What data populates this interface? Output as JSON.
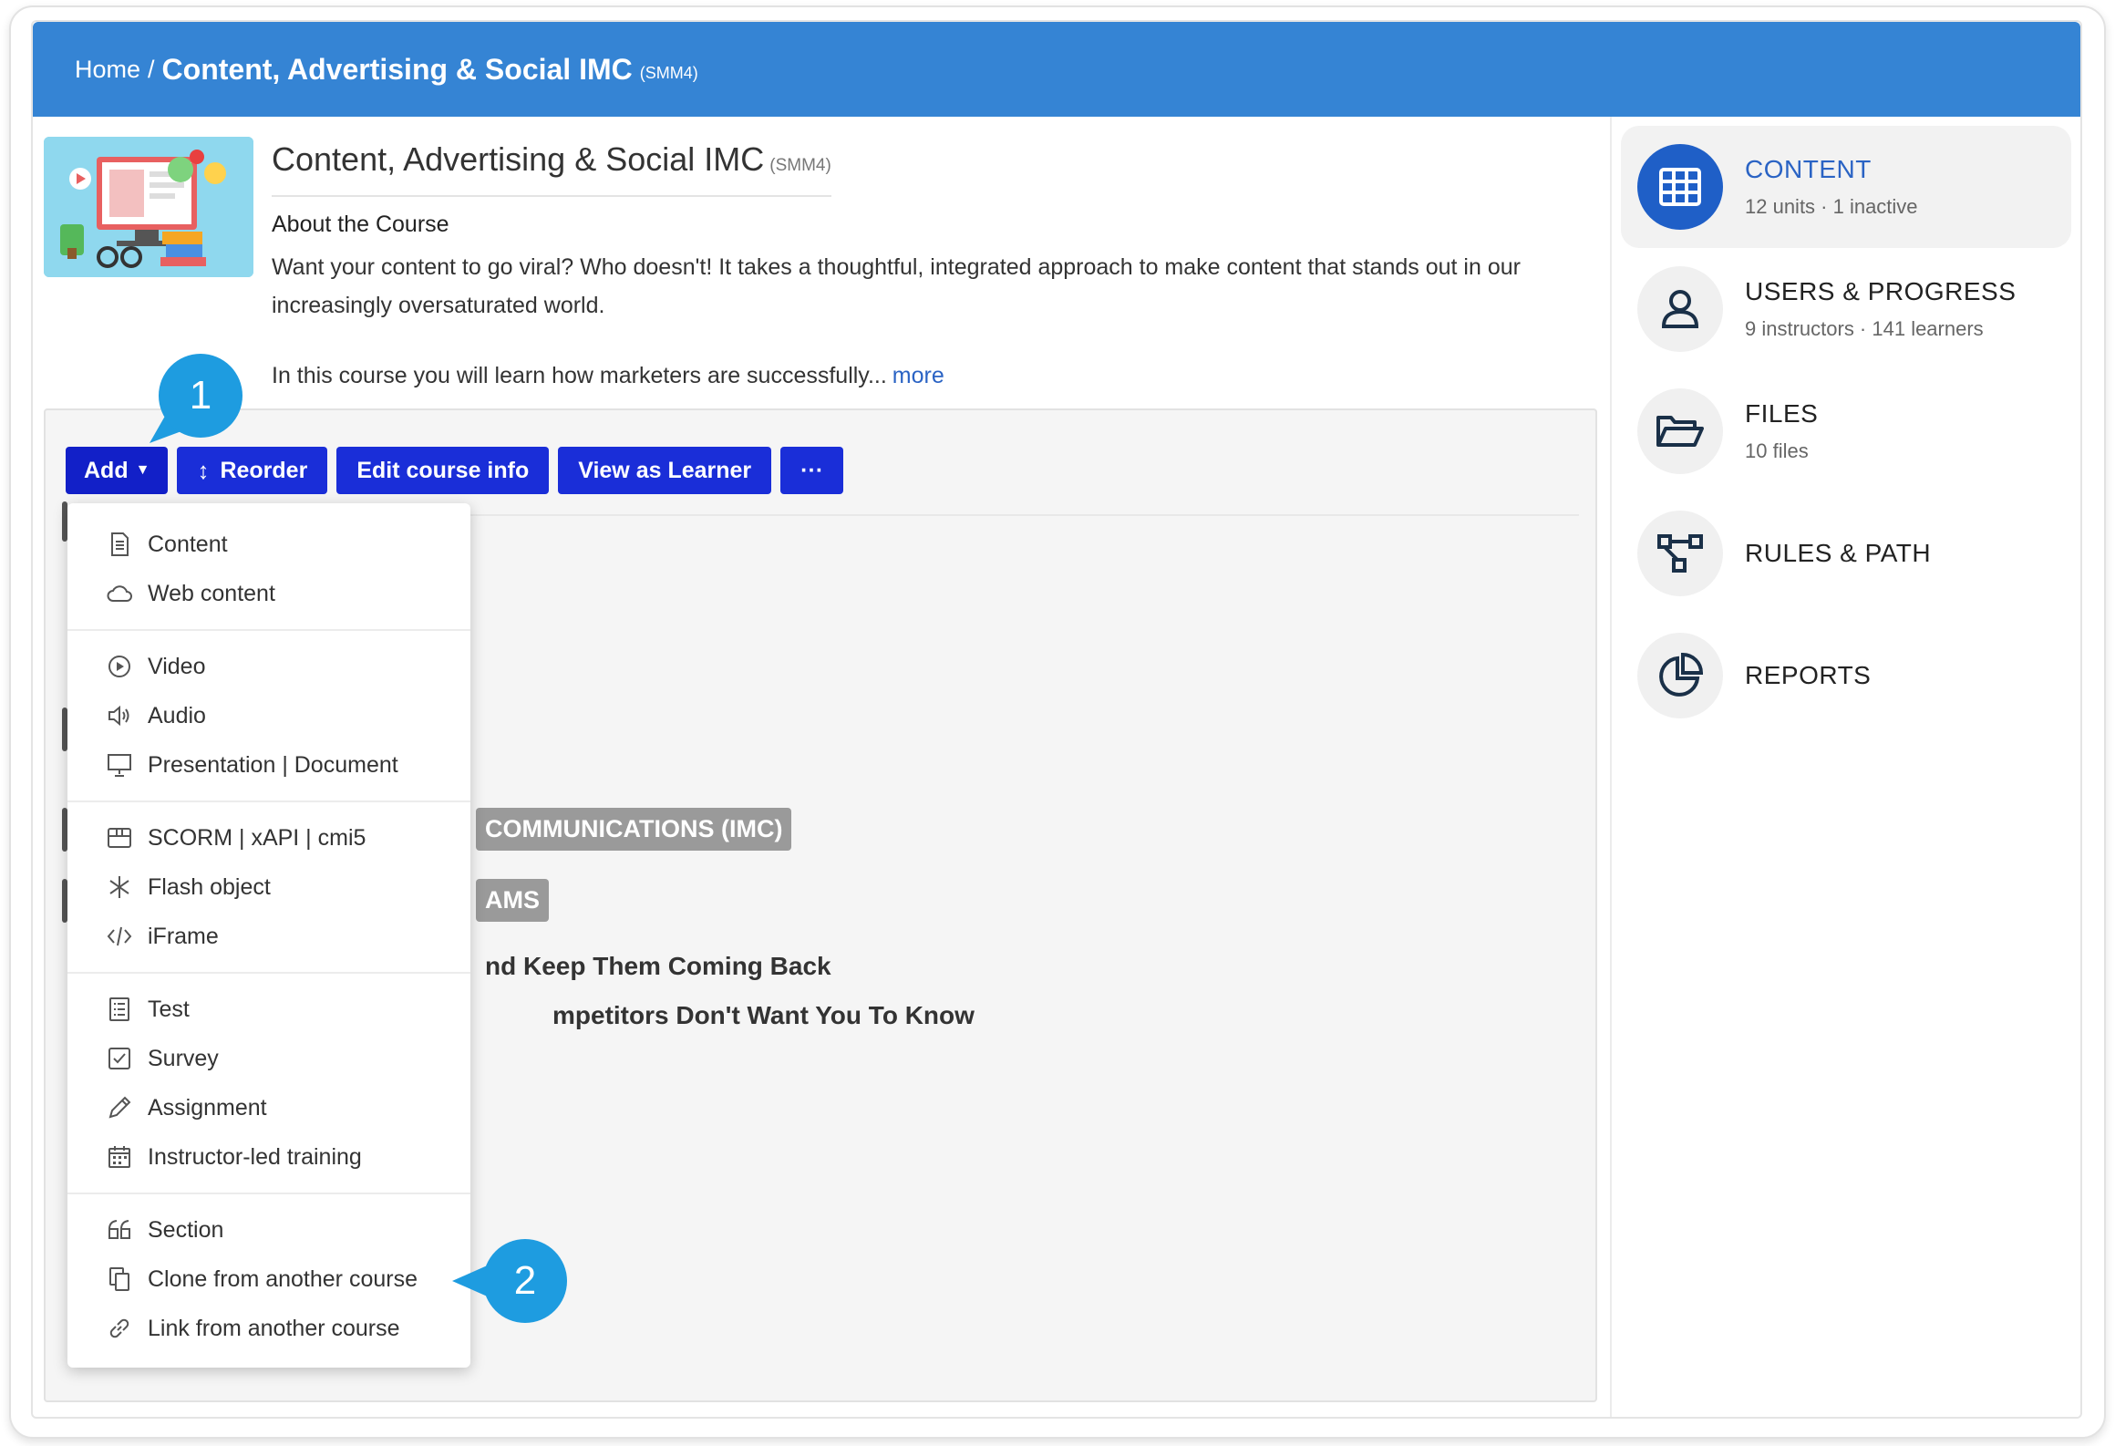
{
  "breadcrumb": {
    "home": "Home",
    "separator": "/",
    "title": "Content, Advertising & Social IMC",
    "code": "(SMM4)"
  },
  "course": {
    "title": "Content, Advertising & Social IMC",
    "code": "(SMM4)",
    "about_heading": "About the Course",
    "about_text": "Want your content to go viral? Who doesn't! It takes a thoughtful, integrated approach to make content that stands out in our increasingly oversaturated world.",
    "about_text2": "In this course you will learn how marketers are successfully...",
    "more": "more"
  },
  "toolbar": {
    "add": "Add",
    "reorder": "Reorder",
    "edit": "Edit course info",
    "view": "View as Learner",
    "more": "···"
  },
  "dropdown": {
    "groups": [
      [
        {
          "label": "Content",
          "icon": "document-icon"
        },
        {
          "label": "Web content",
          "icon": "cloud-icon"
        }
      ],
      [
        {
          "label": "Video",
          "icon": "play-icon"
        },
        {
          "label": "Audio",
          "icon": "speaker-icon"
        },
        {
          "label": "Presentation | Document",
          "icon": "presentation-icon"
        }
      ],
      [
        {
          "label": "SCORM | xAPI | cmi5",
          "icon": "package-icon"
        },
        {
          "label": "Flash object",
          "icon": "asterisk-icon"
        },
        {
          "label": "iFrame",
          "icon": "code-icon"
        }
      ],
      [
        {
          "label": "Test",
          "icon": "test-icon"
        },
        {
          "label": "Survey",
          "icon": "checkbox-icon"
        },
        {
          "label": "Assignment",
          "icon": "pencil-icon"
        },
        {
          "label": "Instructor-led training",
          "icon": "calendar-icon"
        }
      ],
      [
        {
          "label": "Section",
          "icon": "quote-icon"
        },
        {
          "label": "Clone from another course",
          "icon": "clone-icon"
        },
        {
          "label": "Link from another course",
          "icon": "link-icon"
        }
      ]
    ]
  },
  "background_units": {
    "tag1": "COMMUNICATIONS (IMC)",
    "tag2": "AMS",
    "text1": "nd Keep Them Coming Back",
    "text2": "mpetitors Don't Want You To Know"
  },
  "callouts": {
    "one": "1",
    "two": "2"
  },
  "sidebar": {
    "items": [
      {
        "title": "CONTENT",
        "sub": "12 units · 1 inactive",
        "icon": "grid-icon"
      },
      {
        "title": "USERS & PROGRESS",
        "sub": "9 instructors · 141 learners",
        "icon": "user-icon"
      },
      {
        "title": "FILES",
        "sub": "10 files",
        "icon": "folder-icon"
      },
      {
        "title": "RULES & PATH",
        "sub": "",
        "icon": "path-icon"
      },
      {
        "title": "REPORTS",
        "sub": "",
        "icon": "pie-chart-icon"
      }
    ]
  },
  "colors": {
    "header": "#3584d4",
    "button": "#1a2ed8",
    "callout": "#1e9ce0",
    "accent": "#2a63c4"
  }
}
